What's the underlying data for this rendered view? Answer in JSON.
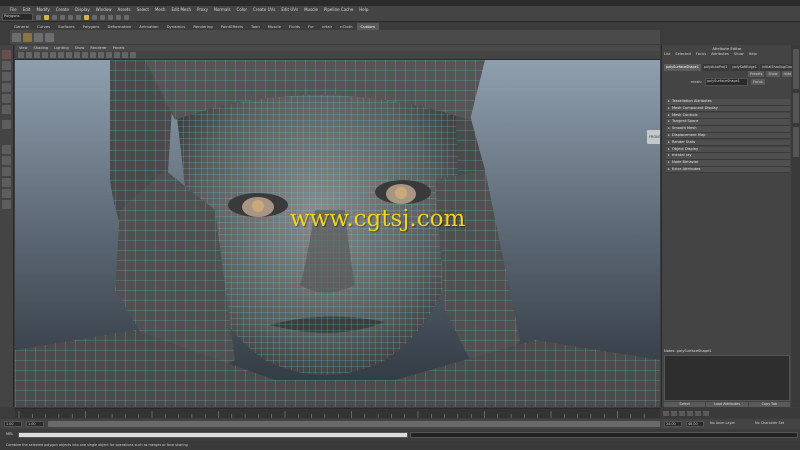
{
  "menubar": {
    "items": [
      "File",
      "Edit",
      "Modify",
      "Create",
      "Display",
      "Window",
      "Assets",
      "Select",
      "Mesh",
      "Edit Mesh",
      "Proxy",
      "Normals",
      "Color",
      "Create UVs",
      "Edit UVs",
      "Muscle",
      "Pipeline Cache",
      "Help"
    ]
  },
  "statusline": {
    "mode": "Polygons"
  },
  "shelf": {
    "tabs": [
      "General",
      "Curves",
      "Surfaces",
      "Polygons",
      "Deformation",
      "Animation",
      "Dynamics",
      "Rendering",
      "PaintEffects",
      "Toon",
      "Muscle",
      "Fluids",
      "Fur",
      "nHair",
      "nCloth",
      "Custom"
    ],
    "active_tab": "Custom"
  },
  "viewport": {
    "menu": [
      "View",
      "Shading",
      "Lighting",
      "Show",
      "Renderer",
      "Panels"
    ],
    "watermark": "www.cgtsj.com",
    "viewcube_label": "FRONT"
  },
  "attribute_editor": {
    "title": "Attribute Editor",
    "menu": [
      "List",
      "Selected",
      "Focus",
      "Attributes",
      "Show",
      "Help"
    ],
    "tabs": [
      "polySurfaceShape1",
      "polyAutoProj1",
      "polySoftEdge1",
      "initialShadingGroup"
    ],
    "active_tab": "polySurfaceShape1",
    "mesh_label": "mesh:",
    "mesh_value": "polySurfaceShape1",
    "focus_btn": "Focus",
    "presets_btn": "Presets",
    "show_btn": "Show",
    "hide_btn": "Hide",
    "sections": [
      "Tessellation Attributes",
      "Mesh Component Display",
      "Mesh Controls",
      "Tangent Space",
      "Smooth Mesh",
      "Displacement Map",
      "Render Stats",
      "Object Display",
      "mental ray",
      "Node Behavior",
      "Extra Attributes"
    ],
    "notes_label": "Notes:  polySurfaceShape1",
    "buttons": [
      "Select",
      "Load Attributes",
      "Copy Tab"
    ]
  },
  "timeslider": {
    "range_start": "1.00",
    "range_start2": "1.00",
    "range_end": "24.00",
    "range_end2": "48.00",
    "anim_layer": "No Anim Layer",
    "char_set": "No Character Set"
  },
  "cmdline": {
    "label": "MEL"
  },
  "helpline": {
    "text": "Combine the selected polygon objects into one single object for operations such as merges or face sharing"
  },
  "colors": {
    "wire": "#58d2e0",
    "watermark": "#f2d51c"
  }
}
